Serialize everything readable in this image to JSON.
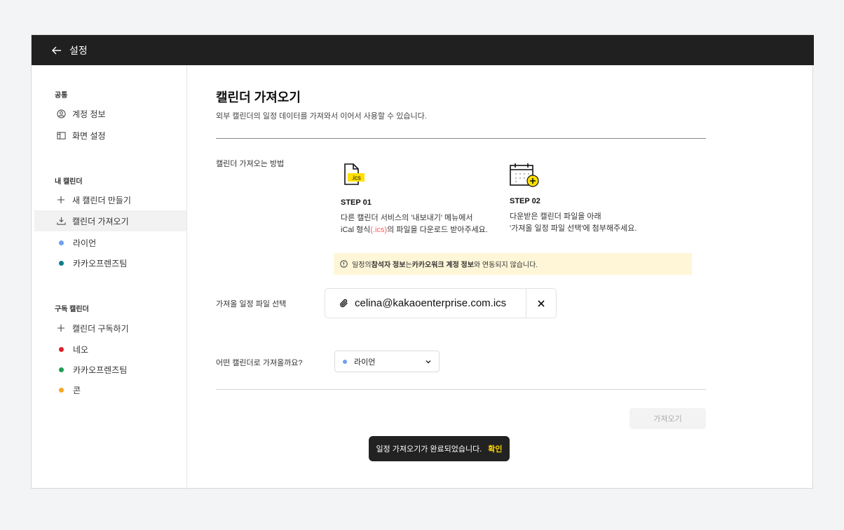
{
  "header": {
    "back_label": "설정"
  },
  "sidebar": {
    "common_title": "공통",
    "common_items": [
      {
        "label": "계정 정보",
        "icon": "user-circle-icon"
      },
      {
        "label": "화면 설정",
        "icon": "layout-icon"
      }
    ],
    "my_title": "내 캘린더",
    "my_items": [
      {
        "label": "새 캘린더 만들기",
        "icon": "plus-icon"
      },
      {
        "label": "캘린더 가져오기",
        "icon": "download-icon",
        "active": true
      },
      {
        "label": "라이언",
        "color": "#6e9ef5"
      },
      {
        "label": "카카오프렌즈팀",
        "color": "#0b7d8a"
      }
    ],
    "sub_title": "구독 캘린더",
    "sub_items": [
      {
        "label": "캘린더 구독하기",
        "icon": "plus-icon"
      },
      {
        "label": "네오",
        "color": "#e0202a"
      },
      {
        "label": "카카오프렌즈팀",
        "color": "#1f9e52"
      },
      {
        "label": "콘",
        "color": "#f7a823"
      }
    ]
  },
  "main": {
    "title": "캘린더 가져오기",
    "subtitle": "외부 캘린더의 일정 데이터를 가져와서 이어서 사용할 수 있습니다.",
    "method_label": "캘린더 가져오는 방법",
    "step1": {
      "badge": ".ics",
      "title": "STEP 01",
      "desc_line1": "다른 캘린더 서비스의 '내보내기' 메뉴에서",
      "desc_line2_pre": "iCal 형식",
      "desc_line2_red": "(.ics)",
      "desc_line2_post": "의 파일을 다운로드 받아주세요."
    },
    "step2": {
      "title": "STEP 02",
      "desc_line1": "다운받은 캘린더 파일을 아래",
      "desc_line2": "'가져올 일정 파일 선택'에 첨부해주세요."
    },
    "notice": {
      "p1": "일정의 ",
      "b1": "참석자 정보",
      "p2": "는 ",
      "b2": "카카오워크 계정 정보",
      "p3": "와 연동되지 않습니다."
    },
    "file_label": "가져올 일정 파일 선택",
    "file_name": "celina@kakaoenterprise.com.ics",
    "target_label": "어떤 캘린더로 가져올까요?",
    "target_value": "라이언",
    "target_color": "#6e9ef5",
    "import_button": "가져오기"
  },
  "toast": {
    "message": "일정 가져오기가 완료되었습니다.",
    "action": "확인"
  }
}
